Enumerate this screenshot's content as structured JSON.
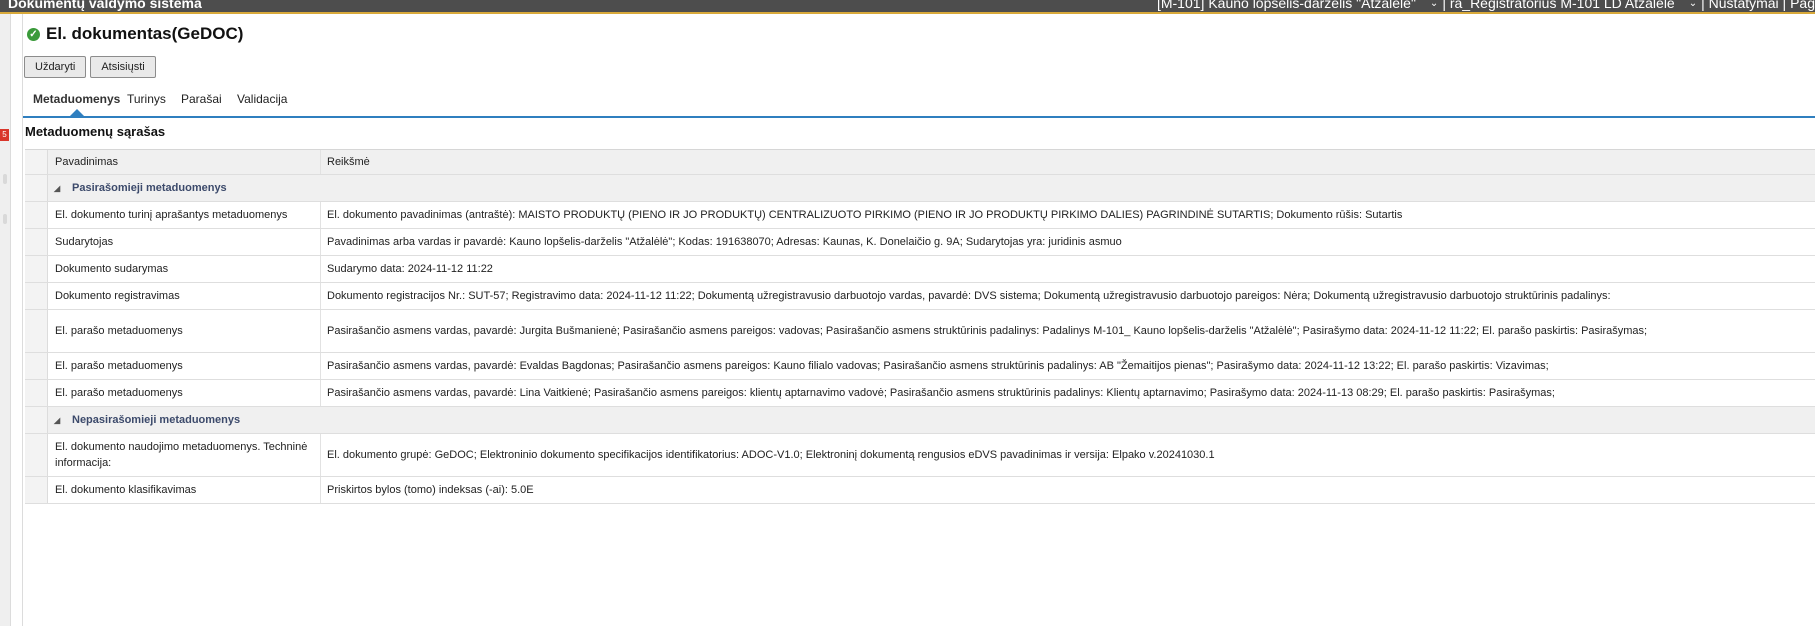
{
  "topbar": {
    "app_title": "Dokumentų valdymo sistema",
    "org_select": "[M-101] Kauno lopšelis-darželis \"Atžalėlė\"",
    "role_select": "| ra_Registratorius M-101 LD Atžalėlė",
    "settings_label": "| Nustatymai | Pag"
  },
  "left": {
    "badge": "5"
  },
  "header": {
    "title": "El. dokumentas(GeDOC)"
  },
  "buttons": {
    "close": "Uždaryti",
    "download": "Atsisiųsti"
  },
  "tabs": [
    {
      "label": "Metaduomenys",
      "active": true
    },
    {
      "label": "Turinys",
      "active": false
    },
    {
      "label": "Parašai",
      "active": false
    },
    {
      "label": "Validacija",
      "active": false
    }
  ],
  "section": {
    "title": "Metaduomenų sąrašas"
  },
  "table": {
    "headers": {
      "name": "Pavadinimas",
      "value": "Reikšmė"
    },
    "groups": [
      {
        "title": "Pasirašomieji metaduomenys",
        "rows": [
          {
            "name": "El. dokumento turinį aprašantys metaduomenys",
            "value": "El. dokumento pavadinimas (antraštė): MAISTO PRODUKTŲ (PIENO IR JO PRODUKTŲ) CENTRALIZUOTO PIRKIMO (PIENO IR JO PRODUKTŲ PIRKIMO DALIES) PAGRINDINĖ SUTARTIS; Dokumento rūšis: Sutartis"
          },
          {
            "name": "Sudarytojas",
            "value": "Pavadinimas arba vardas ir pavardė: Kauno lopšelis-darželis \"Atžalėlė\"; Kodas: 191638070; Adresas: Kaunas, K. Donelaičio g. 9A; Sudarytojas yra: juridinis asmuo"
          },
          {
            "name": "Dokumento sudarymas",
            "value": "Sudarymo data: 2024-11-12 11:22"
          },
          {
            "name": "Dokumento registravimas",
            "value": "Dokumento registracijos Nr.: SUT-57; Registravimo data: 2024-11-12 11:22; Dokumentą užregistravusio darbuotojo vardas, pavardė: DVS sistema; Dokumentą užregistravusio darbuotojo pareigos: Nėra; Dokumentą užregistravusio darbuotojo struktūrinis padalinys:"
          },
          {
            "name": "El. parašo metaduomenys",
            "value": "Pasirašančio asmens vardas, pavardė: Jurgita Bušmanienė; Pasirašančio asmens pareigos: vadovas; Pasirašančio asmens struktūrinis padalinys: Padalinys M-101_ Kauno lopšelis-darželis \"Atžalėlė\"; Pasirašymo data: 2024-11-12 11:22; El. parašo paskirtis: Pasirašymas;",
            "tall": true
          },
          {
            "name": "El. parašo metaduomenys",
            "value": "Pasirašančio asmens vardas, pavardė: Evaldas Bagdonas; Pasirašančio asmens pareigos: Kauno filialo vadovas; Pasirašančio asmens struktūrinis padalinys: AB \"Žemaitijos pienas\"; Pasirašymo data: 2024-11-12 13:22; El. parašo paskirtis: Vizavimas;"
          },
          {
            "name": "El. parašo metaduomenys",
            "value": "Pasirašančio asmens vardas, pavardė: Lina Vaitkienė; Pasirašančio asmens pareigos: klientų aptarnavimo vadovė; Pasirašančio asmens struktūrinis padalinys: Klientų aptarnavimo; Pasirašymo data: 2024-11-13 08:29; El. parašo paskirtis: Pasirašymas;"
          }
        ]
      },
      {
        "title": "Nepasirašomieji metaduomenys",
        "rows": [
          {
            "name": "El. dokumento naudojimo metaduomenys. Techninė informacija:",
            "value": "El. dokumento grupė: GeDOC; Elektroninio dokumento specifikacijos identifikatorius: ADOC-V1.0; Elektroninį dokumentą rengusios eDVS pavadinimas ir versija: Elpako v.20241030.1",
            "tall": true
          },
          {
            "name": "El. dokumento klasifikavimas",
            "value": "Priskirtos bylos (tomo) indeksas (-ai): 5.0E"
          }
        ]
      }
    ]
  }
}
